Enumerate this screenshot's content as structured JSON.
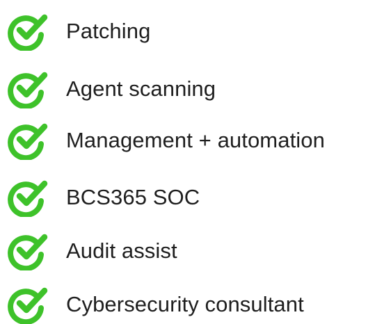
{
  "accent_color": "#3ec22a",
  "text_color": "#1e1e1e",
  "items": [
    {
      "label": "Patching",
      "icon": "check-circle-icon"
    },
    {
      "label": "Agent scanning",
      "icon": "check-circle-icon"
    },
    {
      "label": "Management + automation",
      "icon": "check-circle-icon"
    },
    {
      "label": "BCS365 SOC",
      "icon": "check-circle-icon"
    },
    {
      "label": "Audit assist",
      "icon": "check-circle-icon"
    },
    {
      "label": "Cybersecurity consultant",
      "icon": "check-circle-icon"
    }
  ]
}
